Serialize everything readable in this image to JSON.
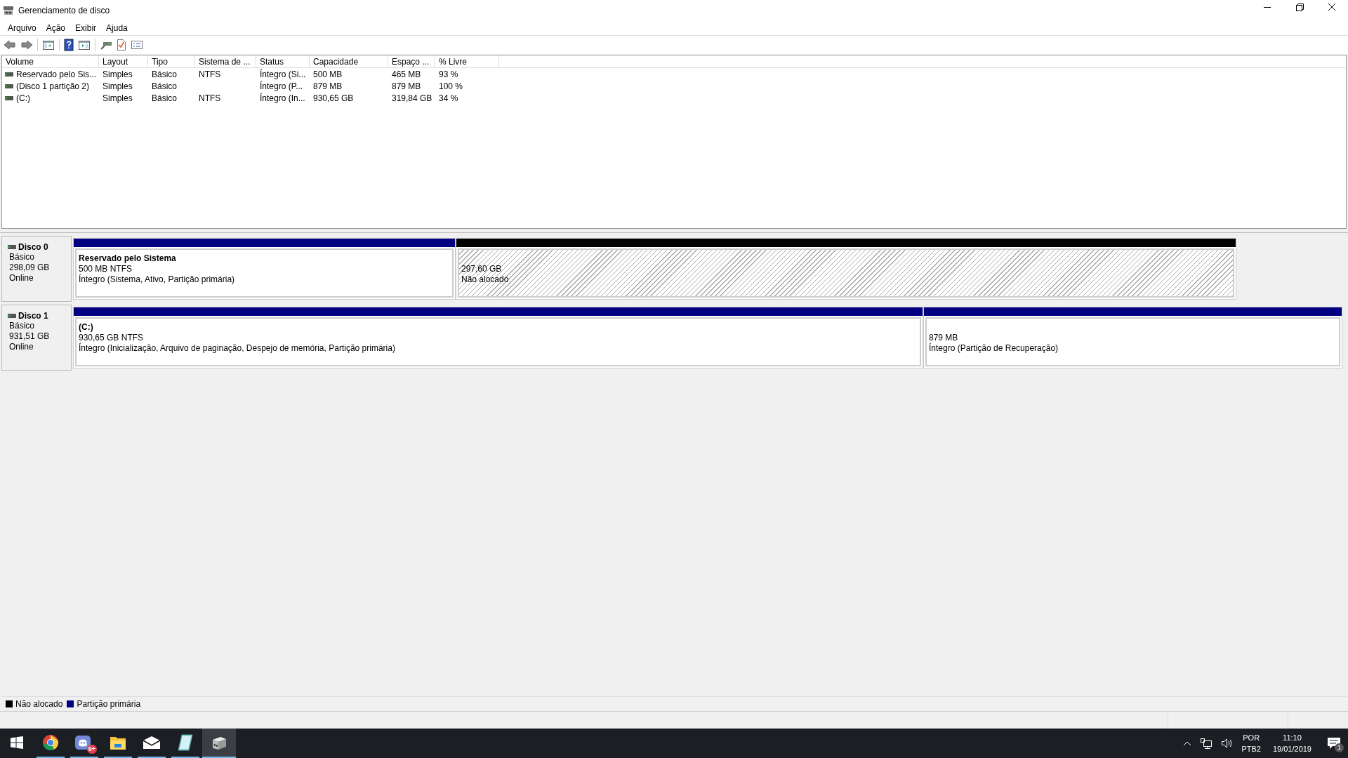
{
  "window": {
    "title": "Gerenciamento de disco"
  },
  "menu": [
    "Arquivo",
    "Ação",
    "Exibir",
    "Ajuda"
  ],
  "toolbar": [
    {
      "kind": "back",
      "disabled": false
    },
    {
      "kind": "forward",
      "disabled": false
    },
    {
      "kind": "sep"
    },
    {
      "kind": "tree"
    },
    {
      "kind": "sep"
    },
    {
      "kind": "help"
    },
    {
      "kind": "pane"
    },
    {
      "kind": "sep"
    },
    {
      "kind": "connect"
    },
    {
      "kind": "check"
    },
    {
      "kind": "list"
    }
  ],
  "table": {
    "columns": [
      "Volume",
      "Layout",
      "Tipo",
      "Sistema de ...",
      "Status",
      "Capacidade",
      "Espaço ...",
      "% Livre"
    ],
    "rows": [
      {
        "cells": [
          "Reservado pelo Sis...",
          "Simples",
          "Básico",
          "NTFS",
          "Íntegro (Si...",
          "500 MB",
          "465 MB",
          "93 %"
        ]
      },
      {
        "cells": [
          "(Disco 1 partição 2)",
          "Simples",
          "Básico",
          "",
          "Íntegro (P...",
          "879 MB",
          "879 MB",
          "100 %"
        ]
      },
      {
        "cells": [
          "(C:)",
          "Simples",
          "Básico",
          "NTFS",
          "Íntegro (In...",
          "930,65 GB",
          "319,84 GB",
          "34 %"
        ]
      }
    ]
  },
  "disks": [
    {
      "name": "Disco 0",
      "type": "Básico",
      "size": "298,09 GB",
      "state": "Online",
      "partitions": [
        {
          "kind": "primary",
          "label": "Reservado pelo Sistema",
          "size": "500 MB NTFS",
          "status": "Íntegro (Sistema, Ativo, Partição primária)"
        },
        {
          "kind": "unallocated",
          "size": "297,60 GB",
          "status": "Não alocado"
        }
      ]
    },
    {
      "name": "Disco 1",
      "type": "Básico",
      "size": "931,51 GB",
      "state": "Online",
      "partitions": [
        {
          "kind": "primary",
          "label": "(C:)",
          "size": "930,65 GB NTFS",
          "status": "Íntegro (Inicialização, Arquivo de paginação, Despejo de memória, Partição primária)"
        },
        {
          "kind": "primary",
          "size": "879 MB",
          "status": "Íntegro (Partição de Recuperação)"
        }
      ]
    }
  ],
  "legend": [
    {
      "label": "Não alocado",
      "color": "#000000"
    },
    {
      "label": "Partição primária",
      "color": "#000080"
    }
  ],
  "taskbar": {
    "apps": [
      {
        "kind": "start",
        "running": false,
        "selected": false
      },
      {
        "kind": "browser",
        "running": true,
        "selected": false
      },
      {
        "kind": "chat",
        "running": true,
        "selected": false,
        "badge": "9+"
      },
      {
        "kind": "folder",
        "running": true,
        "selected": false
      },
      {
        "kind": "mail",
        "running": true,
        "selected": false
      },
      {
        "kind": "notepad",
        "running": true,
        "selected": false
      },
      {
        "kind": "disk",
        "running": true,
        "selected": true
      }
    ],
    "language": "POR",
    "layout": "PTB2",
    "time": "11:10",
    "date": "19/01/2019",
    "notifications": "1"
  }
}
